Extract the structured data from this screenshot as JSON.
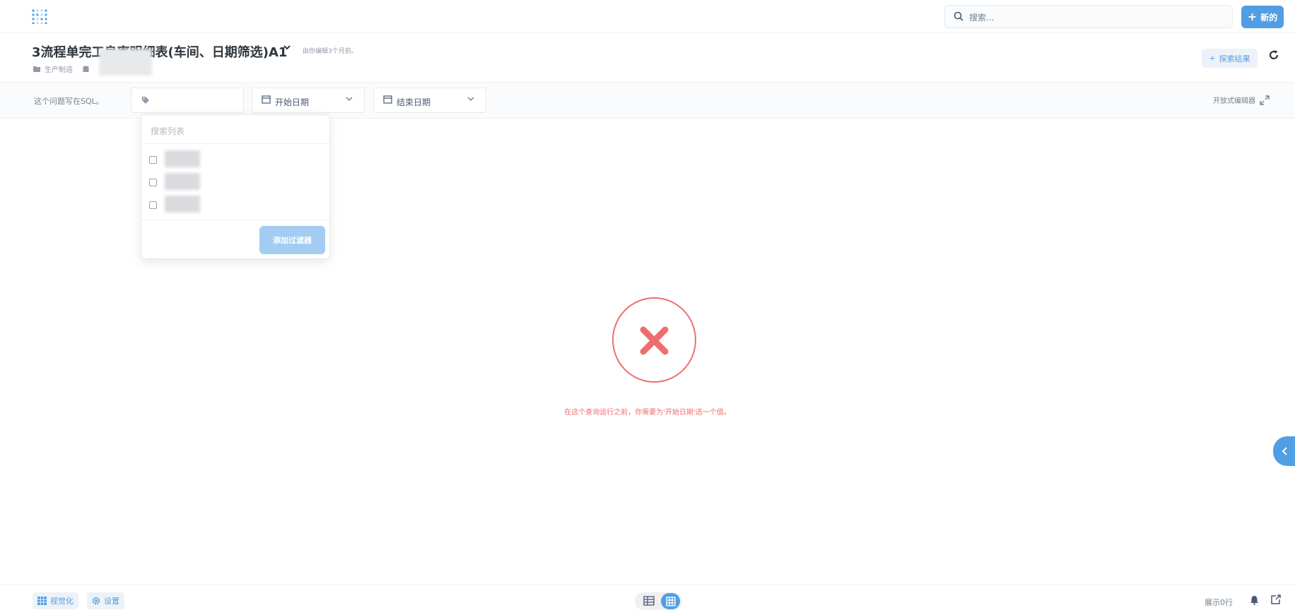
{
  "nav": {
    "search_placeholder": "搜索...",
    "new_label": "新的",
    "new_icon": "plus-icon",
    "logo_icon": "metabase-logo"
  },
  "question": {
    "title": "3流程单完工良率明细表(车间、日期筛选)A1",
    "edited_note": "由你编辑3个月前。",
    "collection": "生产制造",
    "explore_label": "探索结果"
  },
  "filters": {
    "sql_note": "这个问题写在SQL。",
    "start_date_label": "开始日期",
    "end_date_label": "结束日期",
    "open_editor_label": "开放式编辑器"
  },
  "popover": {
    "search_placeholder": "搜索列表",
    "add_button_label": "添加过滤器"
  },
  "error": {
    "message": "在这个查询运行之前，你需要为'开始日期'选一个值。"
  },
  "footer": {
    "visualize_label": "视觉化",
    "settings_label": "设置",
    "row_count_label": "展示0行"
  },
  "colors": {
    "brand": "#509ee3",
    "error": "#ed6e6e",
    "text_dark": "#2e353b"
  }
}
